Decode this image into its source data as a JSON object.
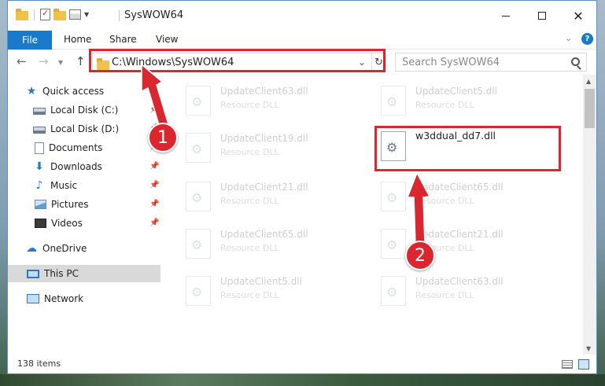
{
  "window": {
    "title": "SysWOW64"
  },
  "ribbon": {
    "tabs": [
      "File",
      "Home",
      "Share",
      "View"
    ],
    "help_label": "?"
  },
  "navigation": {
    "address": "C:\\Windows\\SysWOW64",
    "search_placeholder": "Search SysWOW64"
  },
  "sidebar": {
    "items": [
      {
        "label": "Quick access",
        "icon": "star-icon"
      },
      {
        "label": "Local Disk (C:)",
        "icon": "drive-icon"
      },
      {
        "label": "Local Disk (D:)",
        "icon": "drive-icon"
      },
      {
        "label": "Documents",
        "icon": "documents-icon"
      },
      {
        "label": "Downloads",
        "icon": "download-icon"
      },
      {
        "label": "Music",
        "icon": "music-icon"
      },
      {
        "label": "Pictures",
        "icon": "pictures-icon"
      },
      {
        "label": "Videos",
        "icon": "videos-icon"
      },
      {
        "label": "OneDrive",
        "icon": "onedrive-icon"
      },
      {
        "label": "This PC",
        "icon": "this-pc-icon"
      },
      {
        "label": "Network",
        "icon": "network-icon"
      }
    ],
    "selected": "This PC"
  },
  "files": [
    {
      "name": "UpdateClient63.dll",
      "type": "Resource DLL"
    },
    {
      "name": "UpdateClient5.dll",
      "type": "Resource DLL"
    },
    {
      "name": "UpdateClient19.dll",
      "type": "Resource DLL"
    },
    {
      "name": "w3ddual_dd7.dll",
      "type": ""
    },
    {
      "name": "UpdateClient21.dll",
      "type": "Resource DLL"
    },
    {
      "name": "UpdateClient65.dll",
      "type": "Resource DLL"
    },
    {
      "name": "UpdateClient65.dll",
      "type": "Resource DLL"
    },
    {
      "name": "UpdateClient21.dll",
      "type": "Resource DLL"
    },
    {
      "name": "UpdateClient5.dll",
      "type": "Resource DLL"
    },
    {
      "name": "UpdateClient63.dll",
      "type": "Resource DLL"
    }
  ],
  "status": {
    "item_count": "138 items"
  },
  "annotations": {
    "step1": "1",
    "step2": "2",
    "color": "#d9262f"
  }
}
